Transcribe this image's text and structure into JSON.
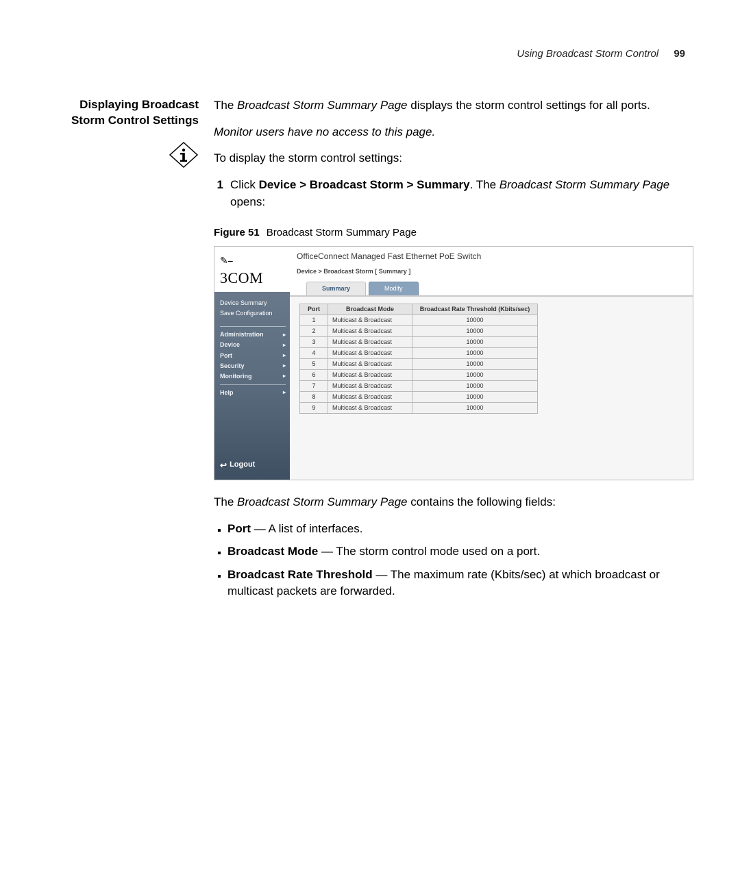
{
  "header": {
    "running": "Using Broadcast Storm Control",
    "page_number": "99"
  },
  "left": {
    "heading": "Displaying Broadcast Storm Control Settings"
  },
  "body": {
    "intro_pre": "The ",
    "intro_em": "Broadcast Storm Summary Page",
    "intro_post": " displays the storm control settings for all ports.",
    "note": "Monitor users have no access to this page.",
    "lead": "To display the storm control settings:",
    "step1_num": "1",
    "step1_a": "Click ",
    "step1_b": "Device > Broadcast Storm > Summary",
    "step1_c": ". The ",
    "step1_d": "Broadcast Storm Summary Page",
    "step1_e": " opens:"
  },
  "figure": {
    "label": "Figure 51",
    "caption": "Broadcast Storm Summary Page"
  },
  "screenshot": {
    "brand": "3COM",
    "product": "OfficeConnect Managed Fast Ethernet PoE Switch",
    "breadcrumb": "Device > Broadcast Storm [ Summary ]",
    "top_links": {
      "a": "Device Summary",
      "b": "Save Configuration"
    },
    "nav": [
      "Administration",
      "Device",
      "Port",
      "Security",
      "Monitoring"
    ],
    "nav2": [
      "Help"
    ],
    "logout": "Logout",
    "tabs": {
      "active": "Summary",
      "other": "Modify"
    },
    "table": {
      "headers": [
        "Port",
        "Broadcast Mode",
        "Broadcast Rate Threshold (Kbits/sec)"
      ],
      "rows": [
        {
          "port": "1",
          "mode": "Multicast & Broadcast",
          "rate": "10000"
        },
        {
          "port": "2",
          "mode": "Multicast & Broadcast",
          "rate": "10000"
        },
        {
          "port": "3",
          "mode": "Multicast & Broadcast",
          "rate": "10000"
        },
        {
          "port": "4",
          "mode": "Multicast & Broadcast",
          "rate": "10000"
        },
        {
          "port": "5",
          "mode": "Multicast & Broadcast",
          "rate": "10000"
        },
        {
          "port": "6",
          "mode": "Multicast & Broadcast",
          "rate": "10000"
        },
        {
          "port": "7",
          "mode": "Multicast & Broadcast",
          "rate": "10000"
        },
        {
          "port": "8",
          "mode": "Multicast & Broadcast",
          "rate": "10000"
        },
        {
          "port": "9",
          "mode": "Multicast & Broadcast",
          "rate": "10000"
        }
      ]
    }
  },
  "after": {
    "lead_a": "The ",
    "lead_b": "Broadcast Storm Summary Page",
    "lead_c": " contains the following fields:",
    "fields": [
      {
        "term": "Port",
        "desc": " — A list of interfaces."
      },
      {
        "term": "Broadcast Mode",
        "desc": " — The storm control mode used on a port."
      },
      {
        "term": "Broadcast Rate Threshold",
        "desc": " — The maximum rate (Kbits/sec) at which broadcast or multicast packets are forwarded."
      }
    ]
  }
}
